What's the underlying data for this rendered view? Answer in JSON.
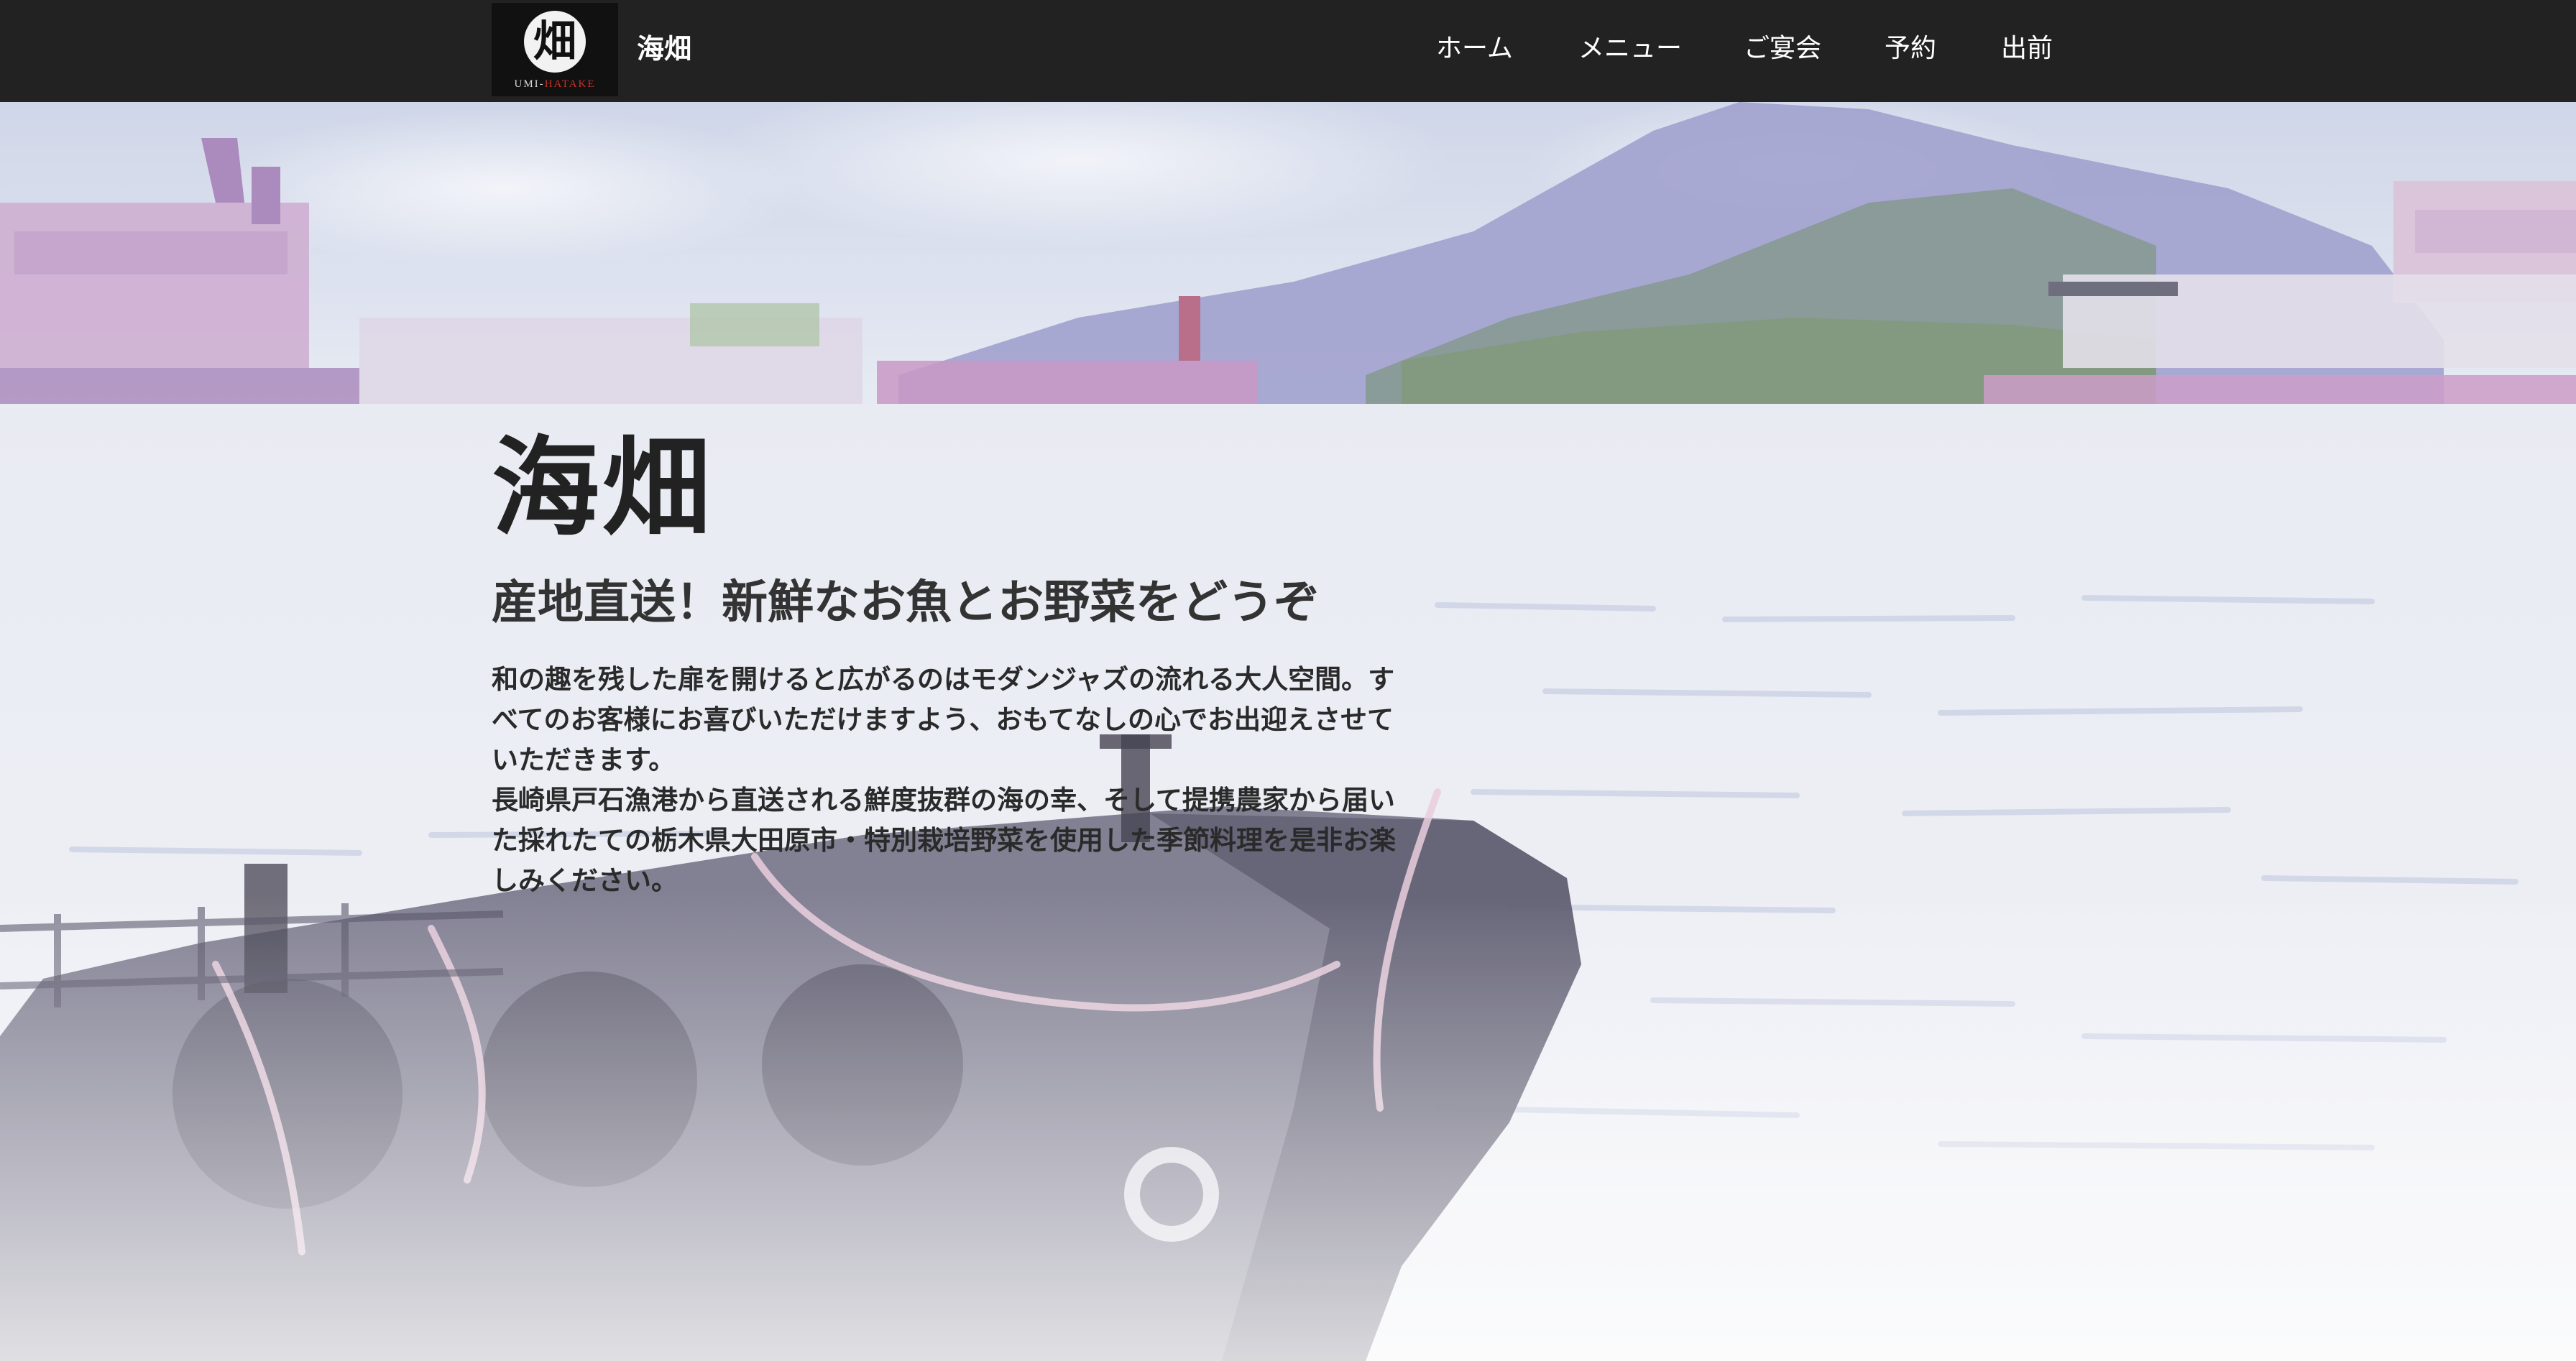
{
  "brand": {
    "logo_kanji": "畑",
    "logo_romaji_prefix": "UMI-",
    "logo_romaji_suffix": "HATAKE",
    "name": "海畑"
  },
  "nav": {
    "items": [
      {
        "label": "ホーム"
      },
      {
        "label": "メニュー"
      },
      {
        "label": "ご宴会"
      },
      {
        "label": "予約"
      },
      {
        "label": "出前"
      }
    ]
  },
  "hero": {
    "title": "海畑",
    "subtitle": "産地直送！新鮮なお魚とお野菜をどうぞ",
    "paragraph1": "和の趣を残した扉を開けると広がるのはモダンジャズの流れる大人空間。すべてのお客様にお喜びいただけますよう、おもてなしの心でお出迎えさせていただきます。",
    "paragraph2": "長崎県戸石漁港から直送される鮮度抜群の海の幸、そして提携農家から届いた採れたての栃木県大田原市・特別栽培野菜を使用した季節料理を是非お楽しみください。"
  },
  "colors": {
    "navbar_bg": "#222222",
    "nav_text": "#ffffff",
    "hero_text": "#222222",
    "logo_accent": "#c0322c"
  }
}
